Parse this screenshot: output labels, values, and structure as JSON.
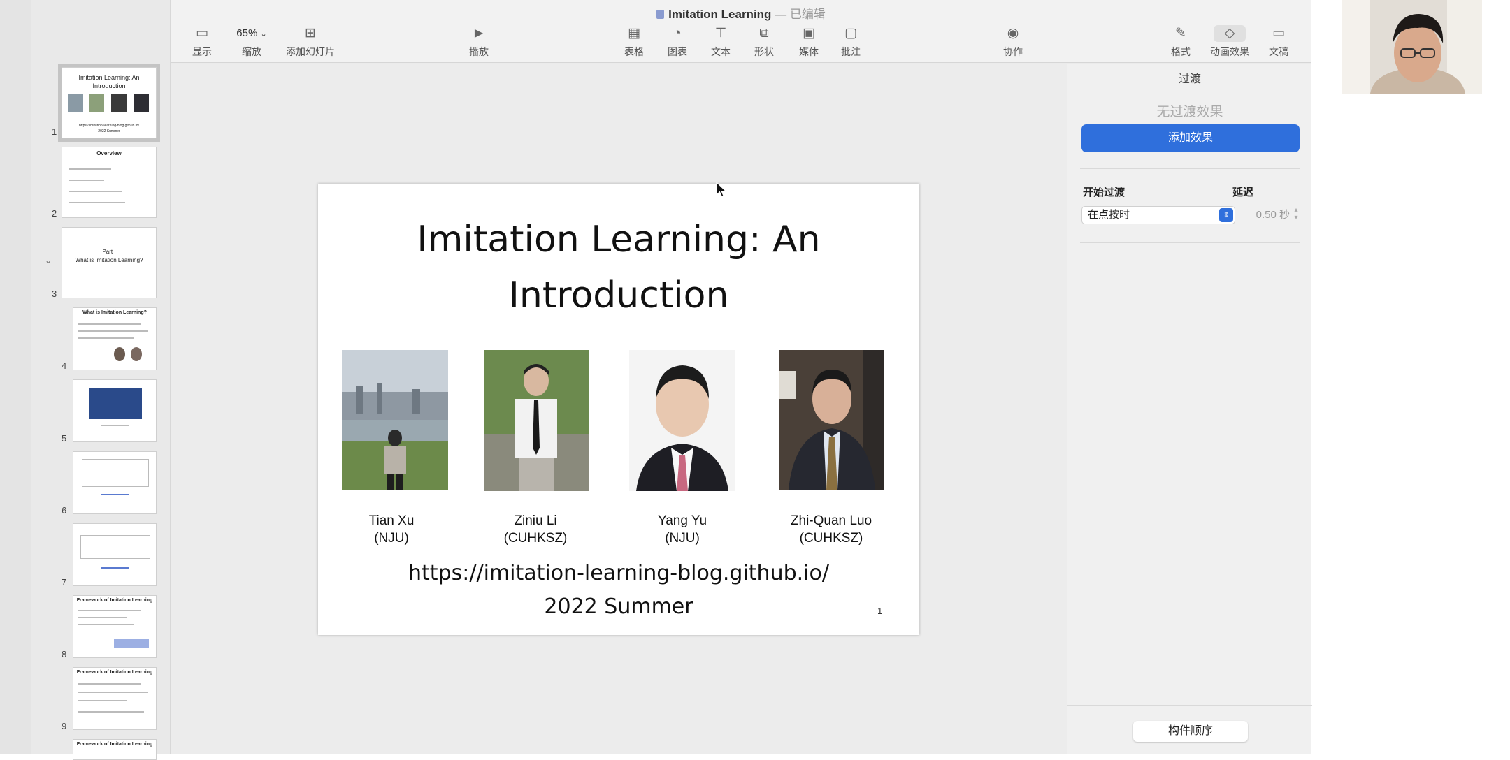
{
  "window": {
    "title": "Imitation Learning",
    "edited_suffix": " — 已编辑"
  },
  "toolbar": {
    "view": "显示",
    "zoom": "缩放",
    "zoom_value": "65%",
    "add_slide": "添加幻灯片",
    "play": "播放",
    "table": "表格",
    "chart": "图表",
    "text": "文本",
    "shape": "形状",
    "media": "媒体",
    "comment": "批注",
    "collaborate": "协作",
    "format": "格式",
    "animate": "动画效果",
    "document": "文稿"
  },
  "slide": {
    "title_line1": "Imitation Learning: An",
    "title_line2": "Introduction",
    "people": [
      {
        "name": "Tian Xu",
        "affiliation": "(NJU)"
      },
      {
        "name": "Ziniu Li",
        "affiliation": "(CUHKSZ)"
      },
      {
        "name": "Yang Yu",
        "affiliation": "(NJU)"
      },
      {
        "name": "Zhi-Quan Luo",
        "affiliation": "(CUHKSZ)"
      }
    ],
    "url": "https://imitation-learning-blog.github.io/",
    "season": "2022 Summer",
    "page_number": "1"
  },
  "inspector": {
    "tab": "过渡",
    "no_transition": "无过渡效果",
    "add_effect": "添加效果",
    "start_label": "开始过渡",
    "delay_label": "延迟",
    "start_value": "在点按时",
    "delay_value": "0.50 秒",
    "order_button": "构件顺序"
  },
  "thumbnails": [
    {
      "num": "1",
      "title": "Imitation Learning: An Introduction",
      "url": "https://imitation-learning-blog.github.io/",
      "season": "2022 Summer"
    },
    {
      "num": "2",
      "title": "Overview"
    },
    {
      "num": "3",
      "title": "Part I",
      "subtitle": "What is Imitation Learning?"
    },
    {
      "num": "4",
      "title": "What is Imitation Learning?"
    },
    {
      "num": "5"
    },
    {
      "num": "6"
    },
    {
      "num": "7"
    },
    {
      "num": "8",
      "title": "Framework of Imitation Learning"
    },
    {
      "num": "9",
      "title": "Framework of Imitation Learning"
    },
    {
      "title": "Framework of Imitation Learning"
    }
  ],
  "colors": {
    "accent": "#2f6fdc",
    "close": "#fe5f57",
    "minimize": "#febc2e",
    "maximize": "#28c840"
  }
}
